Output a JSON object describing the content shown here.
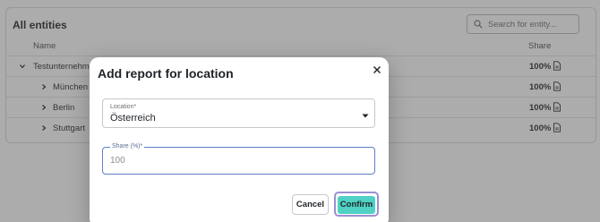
{
  "background": {
    "title": "All entities",
    "search": {
      "placeholder": "Search for entity..."
    },
    "columns": {
      "name": "Name",
      "share": "Share"
    },
    "rows": [
      {
        "name": "Testunternehmen",
        "share": "100%",
        "expanded": true
      },
      {
        "name": "München",
        "share": "100%",
        "expanded": false
      },
      {
        "name": "Berlin",
        "share": "100%",
        "expanded": false
      },
      {
        "name": "Stuttgart",
        "share": "100%",
        "expanded": false
      }
    ]
  },
  "modal": {
    "title": "Add report for location",
    "location": {
      "label": "Location*",
      "value": "Österreich"
    },
    "share": {
      "label": "Share (%)*",
      "placeholder": "100",
      "value": ""
    },
    "cancel_label": "Cancel",
    "confirm_label": "Confirm"
  },
  "colors": {
    "confirm_bg": "#4fd1c4",
    "focus_border": "#5b7fc7",
    "confirm_focus_ring": "#9c8fd0",
    "overlay": "rgba(70,70,70,0.45)"
  }
}
